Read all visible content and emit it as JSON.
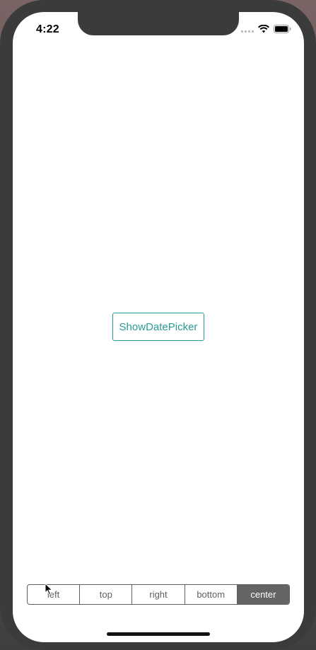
{
  "status_bar": {
    "time": "4:22",
    "icons": [
      "cellular-signal-icon",
      "wifi-icon",
      "battery-icon"
    ]
  },
  "main": {
    "show_button_label": "ShowDatePicker"
  },
  "segmented_control": {
    "items": [
      {
        "label": "left"
      },
      {
        "label": "top"
      },
      {
        "label": "right"
      },
      {
        "label": "bottom"
      },
      {
        "label": "center"
      }
    ],
    "selected": "center"
  },
  "colors": {
    "accent": "#2a9a98",
    "segment_selected_bg": "#646464",
    "segment_border": "#5f5f5f",
    "device_frame": "#3b3b3b"
  }
}
